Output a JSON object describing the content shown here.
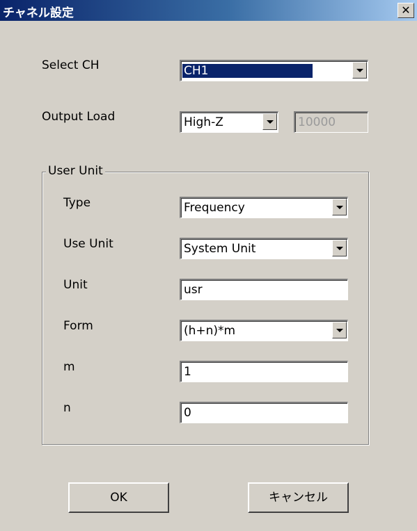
{
  "window": {
    "title": "チャネル設定",
    "close_glyph": "✕"
  },
  "select_ch": {
    "label": "Select CH",
    "value": "CH1"
  },
  "output_load": {
    "label": "Output Load",
    "value": "High-Z",
    "number": "10000"
  },
  "user_unit": {
    "group_title": "User Unit",
    "type": {
      "label": "Type",
      "value": "Frequency"
    },
    "use_unit": {
      "label": "Use Unit",
      "value": "System Unit"
    },
    "unit": {
      "label": "Unit",
      "value": "usr"
    },
    "form": {
      "label": "Form",
      "value": "(h+n)*m"
    },
    "m": {
      "label": "m",
      "value": "1"
    },
    "n": {
      "label": "n",
      "value": "0"
    }
  },
  "buttons": {
    "ok": "OK",
    "cancel": "キャンセル"
  }
}
